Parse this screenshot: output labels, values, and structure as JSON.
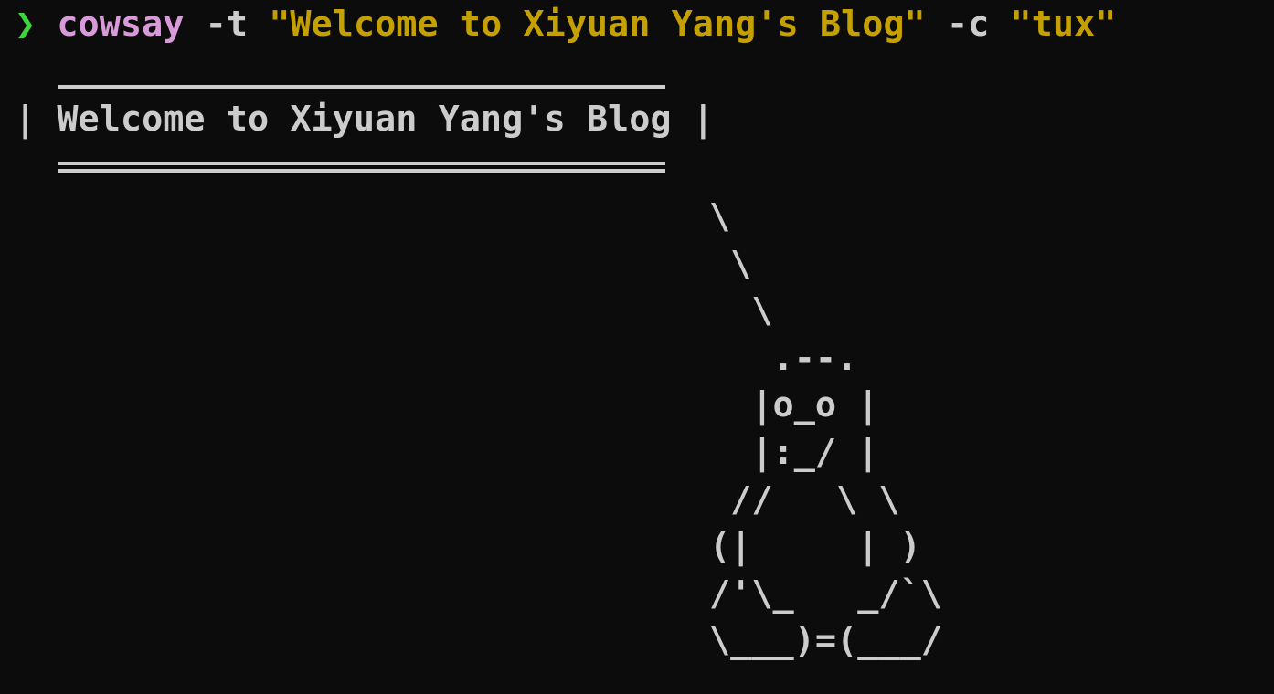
{
  "terminal": {
    "prompt_symbol": "❯",
    "command": {
      "program": "cowsay",
      "flag_t": "-t",
      "text_arg": "\"Welcome to Xiyuan Yang's Blog\"",
      "flag_c": "-c",
      "char_arg": "\"tux\""
    },
    "output": {
      "bubble_text": "| Welcome to Xiyuan Yang's Blog |",
      "tux_art": "\\\n \\\n  \\\n   .--.\n  |o_o |\n  |:_/ |\n //   \\ \\\n(|     | )\n/'\\_   _/`\\\n\\___)=(___/"
    },
    "colors": {
      "background": "#0c0c0c",
      "prompt": "#3fd33c",
      "command": "#d99ad9",
      "string": "#c4a000",
      "text": "#cccccc"
    }
  }
}
